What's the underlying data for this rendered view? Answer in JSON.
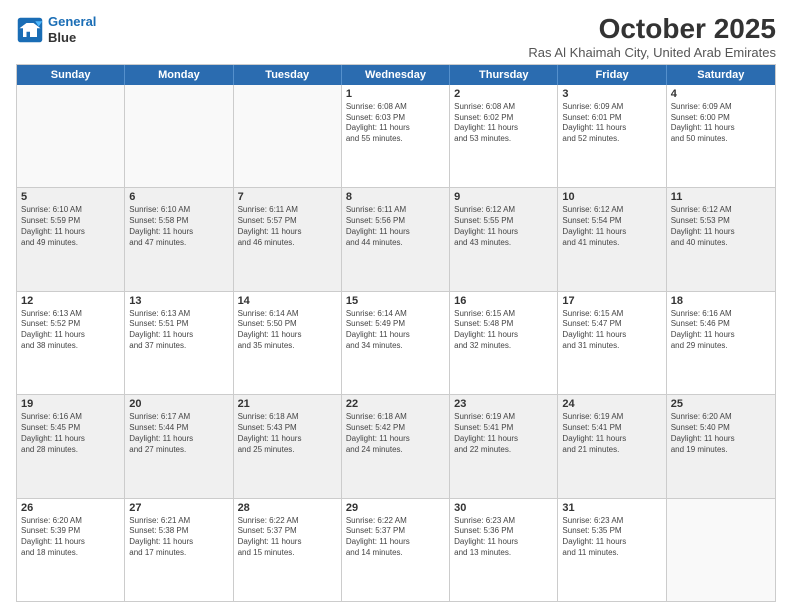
{
  "logo": {
    "line1": "General",
    "line2": "Blue"
  },
  "header": {
    "month": "October 2025",
    "location": "Ras Al Khaimah City, United Arab Emirates"
  },
  "weekdays": [
    "Sunday",
    "Monday",
    "Tuesday",
    "Wednesday",
    "Thursday",
    "Friday",
    "Saturday"
  ],
  "weeks": [
    [
      {
        "day": "",
        "info": "",
        "shaded": false,
        "empty": true
      },
      {
        "day": "",
        "info": "",
        "shaded": false,
        "empty": true
      },
      {
        "day": "",
        "info": "",
        "shaded": false,
        "empty": true
      },
      {
        "day": "1",
        "info": "Sunrise: 6:08 AM\nSunset: 6:03 PM\nDaylight: 11 hours\nand 55 minutes.",
        "shaded": false
      },
      {
        "day": "2",
        "info": "Sunrise: 6:08 AM\nSunset: 6:02 PM\nDaylight: 11 hours\nand 53 minutes.",
        "shaded": false
      },
      {
        "day": "3",
        "info": "Sunrise: 6:09 AM\nSunset: 6:01 PM\nDaylight: 11 hours\nand 52 minutes.",
        "shaded": false
      },
      {
        "day": "4",
        "info": "Sunrise: 6:09 AM\nSunset: 6:00 PM\nDaylight: 11 hours\nand 50 minutes.",
        "shaded": false
      }
    ],
    [
      {
        "day": "5",
        "info": "Sunrise: 6:10 AM\nSunset: 5:59 PM\nDaylight: 11 hours\nand 49 minutes.",
        "shaded": true
      },
      {
        "day": "6",
        "info": "Sunrise: 6:10 AM\nSunset: 5:58 PM\nDaylight: 11 hours\nand 47 minutes.",
        "shaded": true
      },
      {
        "day": "7",
        "info": "Sunrise: 6:11 AM\nSunset: 5:57 PM\nDaylight: 11 hours\nand 46 minutes.",
        "shaded": true
      },
      {
        "day": "8",
        "info": "Sunrise: 6:11 AM\nSunset: 5:56 PM\nDaylight: 11 hours\nand 44 minutes.",
        "shaded": true
      },
      {
        "day": "9",
        "info": "Sunrise: 6:12 AM\nSunset: 5:55 PM\nDaylight: 11 hours\nand 43 minutes.",
        "shaded": true
      },
      {
        "day": "10",
        "info": "Sunrise: 6:12 AM\nSunset: 5:54 PM\nDaylight: 11 hours\nand 41 minutes.",
        "shaded": true
      },
      {
        "day": "11",
        "info": "Sunrise: 6:12 AM\nSunset: 5:53 PM\nDaylight: 11 hours\nand 40 minutes.",
        "shaded": true
      }
    ],
    [
      {
        "day": "12",
        "info": "Sunrise: 6:13 AM\nSunset: 5:52 PM\nDaylight: 11 hours\nand 38 minutes.",
        "shaded": false
      },
      {
        "day": "13",
        "info": "Sunrise: 6:13 AM\nSunset: 5:51 PM\nDaylight: 11 hours\nand 37 minutes.",
        "shaded": false
      },
      {
        "day": "14",
        "info": "Sunrise: 6:14 AM\nSunset: 5:50 PM\nDaylight: 11 hours\nand 35 minutes.",
        "shaded": false
      },
      {
        "day": "15",
        "info": "Sunrise: 6:14 AM\nSunset: 5:49 PM\nDaylight: 11 hours\nand 34 minutes.",
        "shaded": false
      },
      {
        "day": "16",
        "info": "Sunrise: 6:15 AM\nSunset: 5:48 PM\nDaylight: 11 hours\nand 32 minutes.",
        "shaded": false
      },
      {
        "day": "17",
        "info": "Sunrise: 6:15 AM\nSunset: 5:47 PM\nDaylight: 11 hours\nand 31 minutes.",
        "shaded": false
      },
      {
        "day": "18",
        "info": "Sunrise: 6:16 AM\nSunset: 5:46 PM\nDaylight: 11 hours\nand 29 minutes.",
        "shaded": false
      }
    ],
    [
      {
        "day": "19",
        "info": "Sunrise: 6:16 AM\nSunset: 5:45 PM\nDaylight: 11 hours\nand 28 minutes.",
        "shaded": true
      },
      {
        "day": "20",
        "info": "Sunrise: 6:17 AM\nSunset: 5:44 PM\nDaylight: 11 hours\nand 27 minutes.",
        "shaded": true
      },
      {
        "day": "21",
        "info": "Sunrise: 6:18 AM\nSunset: 5:43 PM\nDaylight: 11 hours\nand 25 minutes.",
        "shaded": true
      },
      {
        "day": "22",
        "info": "Sunrise: 6:18 AM\nSunset: 5:42 PM\nDaylight: 11 hours\nand 24 minutes.",
        "shaded": true
      },
      {
        "day": "23",
        "info": "Sunrise: 6:19 AM\nSunset: 5:41 PM\nDaylight: 11 hours\nand 22 minutes.",
        "shaded": true
      },
      {
        "day": "24",
        "info": "Sunrise: 6:19 AM\nSunset: 5:41 PM\nDaylight: 11 hours\nand 21 minutes.",
        "shaded": true
      },
      {
        "day": "25",
        "info": "Sunrise: 6:20 AM\nSunset: 5:40 PM\nDaylight: 11 hours\nand 19 minutes.",
        "shaded": true
      }
    ],
    [
      {
        "day": "26",
        "info": "Sunrise: 6:20 AM\nSunset: 5:39 PM\nDaylight: 11 hours\nand 18 minutes.",
        "shaded": false
      },
      {
        "day": "27",
        "info": "Sunrise: 6:21 AM\nSunset: 5:38 PM\nDaylight: 11 hours\nand 17 minutes.",
        "shaded": false
      },
      {
        "day": "28",
        "info": "Sunrise: 6:22 AM\nSunset: 5:37 PM\nDaylight: 11 hours\nand 15 minutes.",
        "shaded": false
      },
      {
        "day": "29",
        "info": "Sunrise: 6:22 AM\nSunset: 5:37 PM\nDaylight: 11 hours\nand 14 minutes.",
        "shaded": false
      },
      {
        "day": "30",
        "info": "Sunrise: 6:23 AM\nSunset: 5:36 PM\nDaylight: 11 hours\nand 13 minutes.",
        "shaded": false
      },
      {
        "day": "31",
        "info": "Sunrise: 6:23 AM\nSunset: 5:35 PM\nDaylight: 11 hours\nand 11 minutes.",
        "shaded": false
      },
      {
        "day": "",
        "info": "",
        "shaded": false,
        "empty": true
      }
    ]
  ]
}
